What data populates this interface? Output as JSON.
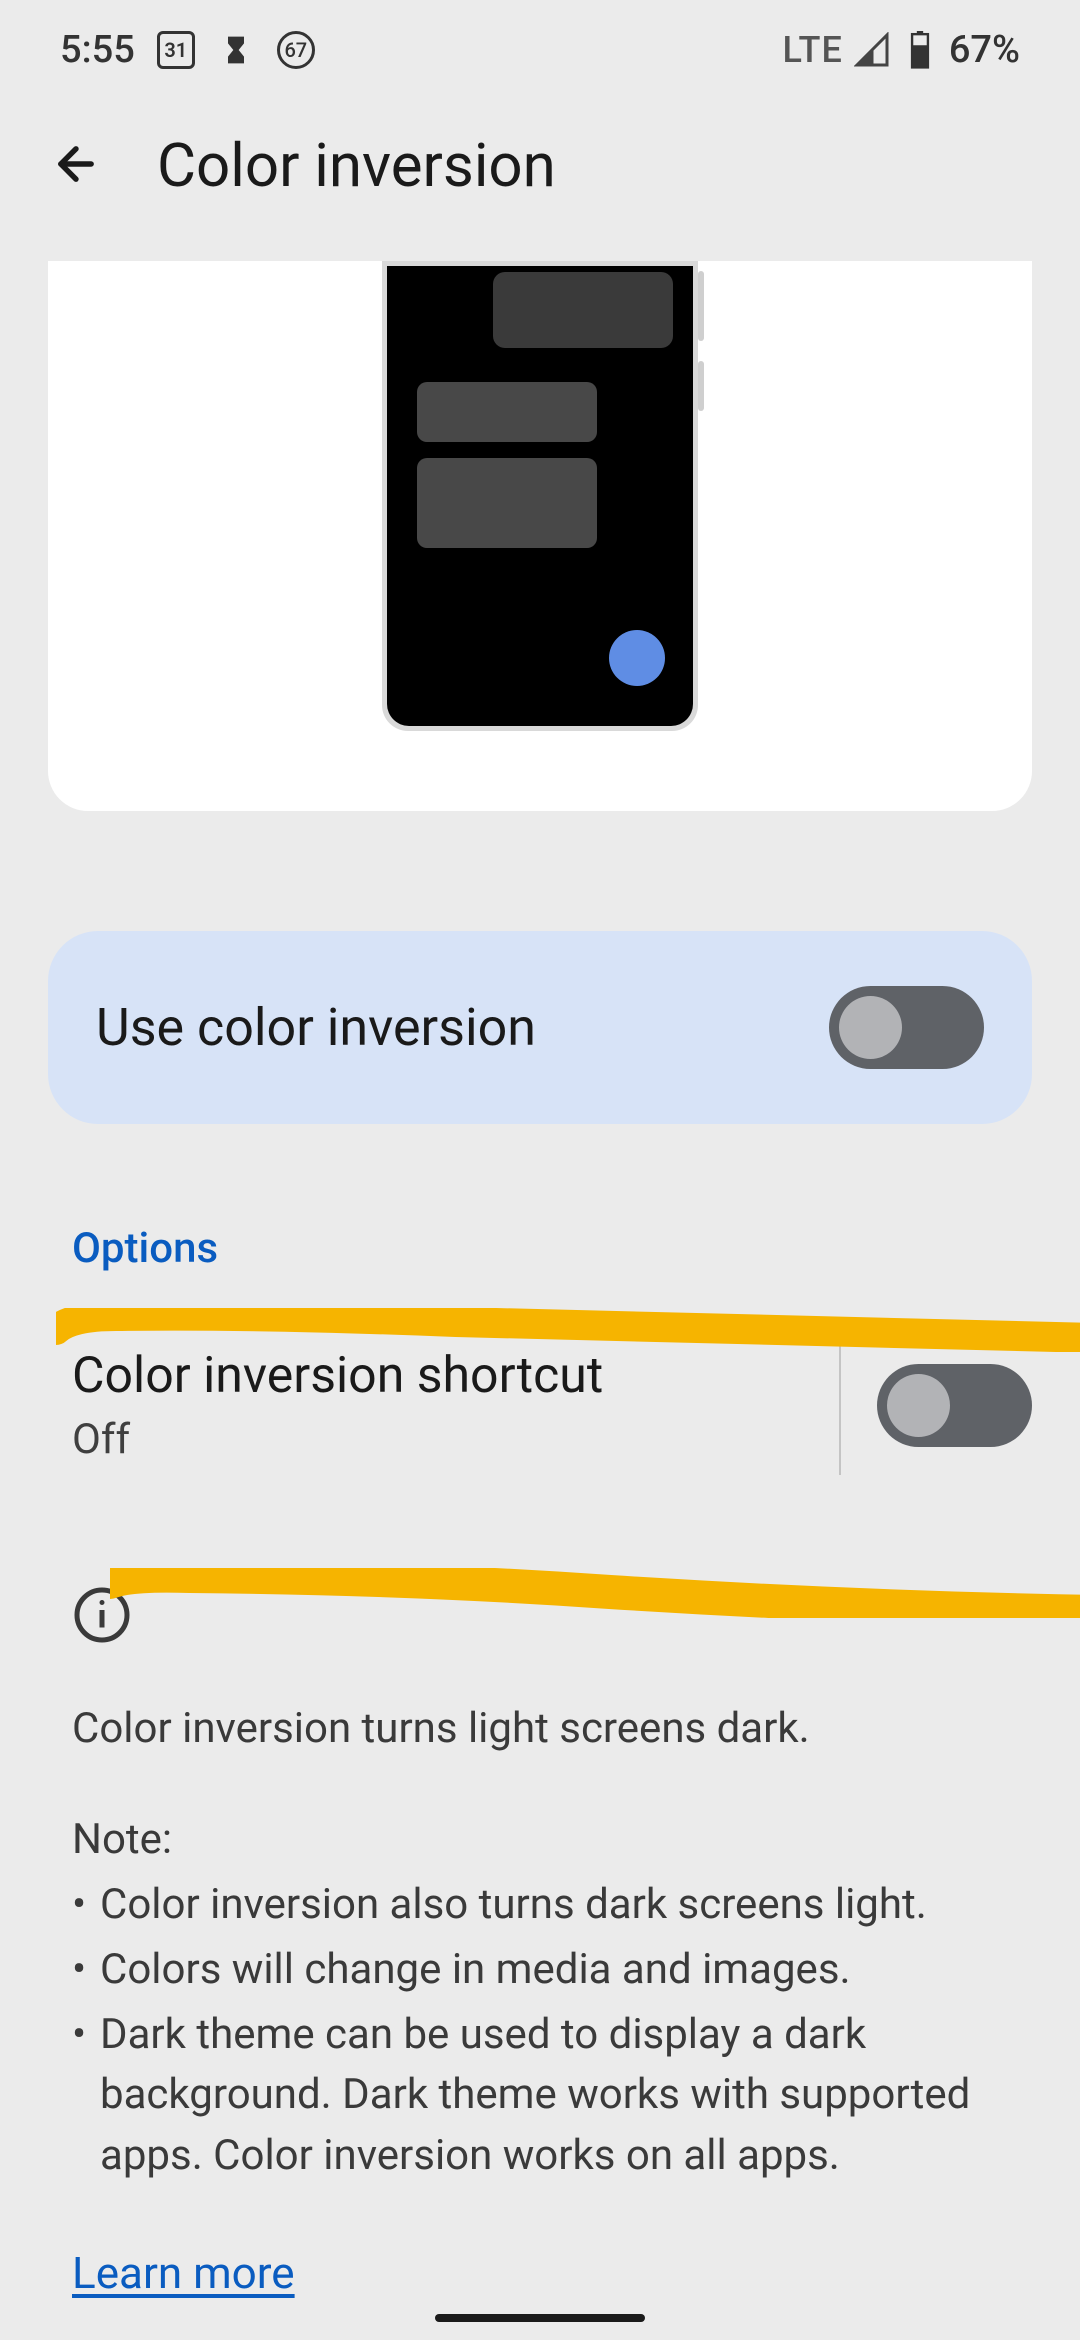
{
  "status": {
    "time": "5:55",
    "cal_day": "31",
    "circled_num": "67",
    "network": "LTE",
    "battery_pct": "67%"
  },
  "header": {
    "title": "Color inversion"
  },
  "main_toggle": {
    "label": "Use color inversion"
  },
  "section": {
    "header": "Options"
  },
  "shortcut": {
    "title": "Color inversion shortcut",
    "status": "Off"
  },
  "info": {
    "line1": "Color inversion turns light screens dark.",
    "note_label": "Note:",
    "bullet1": "Color inversion also turns dark screens light.",
    "bullet2": "Colors will change in media and images.",
    "bullet3": "Dark theme can be used to display a dark background. Dark theme works with supported apps. Color inversion works on all apps."
  },
  "learn_more": "Learn more"
}
